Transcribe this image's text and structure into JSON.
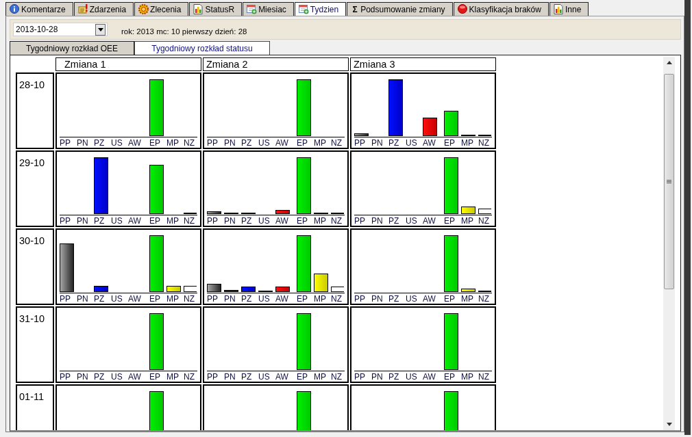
{
  "tabs": [
    {
      "label": "Komentarze",
      "kind": "info",
      "selected": false
    },
    {
      "label": "Zdarzenia",
      "kind": "warning",
      "selected": false
    },
    {
      "label": "Zlecenia",
      "kind": "gear",
      "selected": false
    },
    {
      "label": "StatusR",
      "kind": "chart",
      "selected": false
    },
    {
      "label": "Miesiac",
      "kind": "calendar",
      "selected": false
    },
    {
      "label": "Tydzien",
      "kind": "calendar",
      "selected": true
    },
    {
      "label": "Podsumowanie zmiany",
      "kind": "glyph",
      "glyph": "Σ",
      "selected": false
    },
    {
      "label": "Klasyfikacja braków",
      "kind": "stop",
      "selected": false
    },
    {
      "label": "Inne",
      "kind": "chart",
      "selected": false
    }
  ],
  "date_field": {
    "value": "2013-10-28"
  },
  "date_info": "rok: 2013 mc: 10 pierwszy dzień: 28",
  "subtabs": [
    {
      "label": "Tygodniowy rozkład OEE",
      "selected": false
    },
    {
      "label": "Tygodniowy rozkład statusu",
      "selected": true
    }
  ],
  "grid": {
    "columns": [
      "Zmiana 1",
      "Zmiana 2",
      "Zmiana 3"
    ],
    "rows": [
      {
        "date": "28-10",
        "cells": [
          {
            "labels": [
              "PP",
              "PN",
              "PZ",
              "US",
              "AW",
              "EP",
              "MP",
              "NZ"
            ]
          },
          {
            "labels": [
              "PP",
              "PN",
              "PZ",
              "US",
              "AW",
              "EP",
              "MP",
              "NZ"
            ]
          },
          {
            "labels": [
              "PP",
              "PN",
              "PZ",
              "US",
              "AW",
              "EP",
              "MP",
              "NZ"
            ]
          }
        ]
      },
      {
        "date": "29-10",
        "cells": [
          {
            "labels": [
              "PP",
              "PN",
              "PZ",
              "US",
              "AW",
              "EP",
              "MP",
              "NZ"
            ]
          },
          {
            "labels": [
              "PP",
              "PN",
              "PZ",
              "US",
              "AW",
              "EP",
              "MP",
              "NZ"
            ]
          },
          {
            "labels": [
              "PP",
              "PN",
              "PZ",
              "US",
              "AW",
              "EP",
              "MP",
              "NZ"
            ]
          }
        ]
      },
      {
        "date": "30-10",
        "cells": [
          {
            "labels": [
              "PP",
              "PN",
              "PZ",
              "US",
              "AW",
              "EP",
              "MP",
              "NZ"
            ]
          },
          {
            "labels": [
              "PP",
              "PN",
              "PZ",
              "US",
              "AW",
              "EP",
              "MP",
              "NZ"
            ]
          },
          {
            "labels": [
              "PP",
              "PN",
              "PZ",
              "US",
              "AW",
              "EP",
              "MP",
              "NZ"
            ]
          }
        ]
      },
      {
        "date": "31-10",
        "cells": [
          {
            "labels": [
              "PP",
              "PN",
              "PZ",
              "US",
              "AW",
              "EP",
              "MP",
              "NZ"
            ]
          },
          {
            "labels": [
              "PP",
              "PN",
              "PZ",
              "US",
              "AW",
              "EP",
              "MP",
              "NZ"
            ]
          },
          {
            "labels": [
              "PP",
              "PN",
              "PZ",
              "US",
              "AW",
              "EP",
              "MP",
              "NZ"
            ]
          }
        ]
      },
      {
        "date": "01-11"
      }
    ]
  }
}
